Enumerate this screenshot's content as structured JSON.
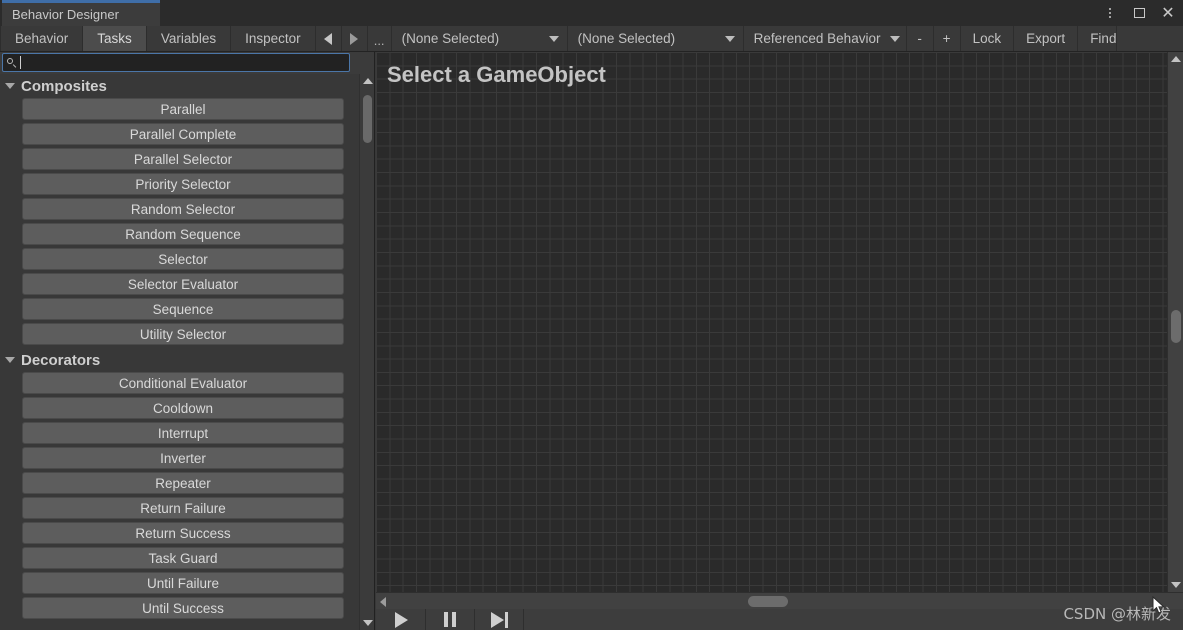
{
  "window": {
    "tab_title": "Behavior Designer",
    "controls": [
      {
        "name": "kebab-menu-icon",
        "label": "⋮"
      },
      {
        "name": "maximize-icon",
        "label": "□"
      },
      {
        "name": "close-icon",
        "label": "✕"
      }
    ]
  },
  "toolbar": {
    "tabs": [
      {
        "label": "Behavior",
        "active": false
      },
      {
        "label": "Tasks",
        "active": true
      },
      {
        "label": "Variables",
        "active": false
      },
      {
        "label": "Inspector",
        "active": false
      }
    ],
    "back_icon": "triangle-left-icon",
    "forward_icon": "triangle-right-icon",
    "more_label": "...",
    "dropdown_gameobject": "(None Selected)",
    "dropdown_behavior": "(None Selected)",
    "dropdown_referenced_behavior": "Referenced Behavior",
    "zoom_out_label": "-",
    "zoom_in_label": "+",
    "lock_label": "Lock",
    "export_label": "Export",
    "find_label": "Find"
  },
  "search": {
    "value": "",
    "placeholder": "",
    "icon": "search-icon"
  },
  "task_list": {
    "categories": [
      {
        "name": "Composites",
        "expanded": true,
        "items": [
          "Parallel",
          "Parallel Complete",
          "Parallel Selector",
          "Priority Selector",
          "Random Selector",
          "Random Sequence",
          "Selector",
          "Selector Evaluator",
          "Sequence",
          "Utility Selector"
        ]
      },
      {
        "name": "Decorators",
        "expanded": true,
        "items": [
          "Conditional Evaluator",
          "Cooldown",
          "Interrupt",
          "Inverter",
          "Repeater",
          "Return Failure",
          "Return Success",
          "Task Guard",
          "Until Failure",
          "Until Success"
        ]
      }
    ]
  },
  "canvas": {
    "title": "Select a GameObject"
  },
  "playbar": {
    "play_label": "play-icon",
    "pause_label": "pause-icon",
    "step_label": "step-forward-icon"
  },
  "watermark": {
    "text": "CSDN @林新发"
  },
  "colors": {
    "accent": "#3f6ea8",
    "panel_bg": "#383838",
    "canvas_bg": "#2a2a2a",
    "item_bg": "#5d5d5d",
    "focus_border": "#4b76a8"
  }
}
